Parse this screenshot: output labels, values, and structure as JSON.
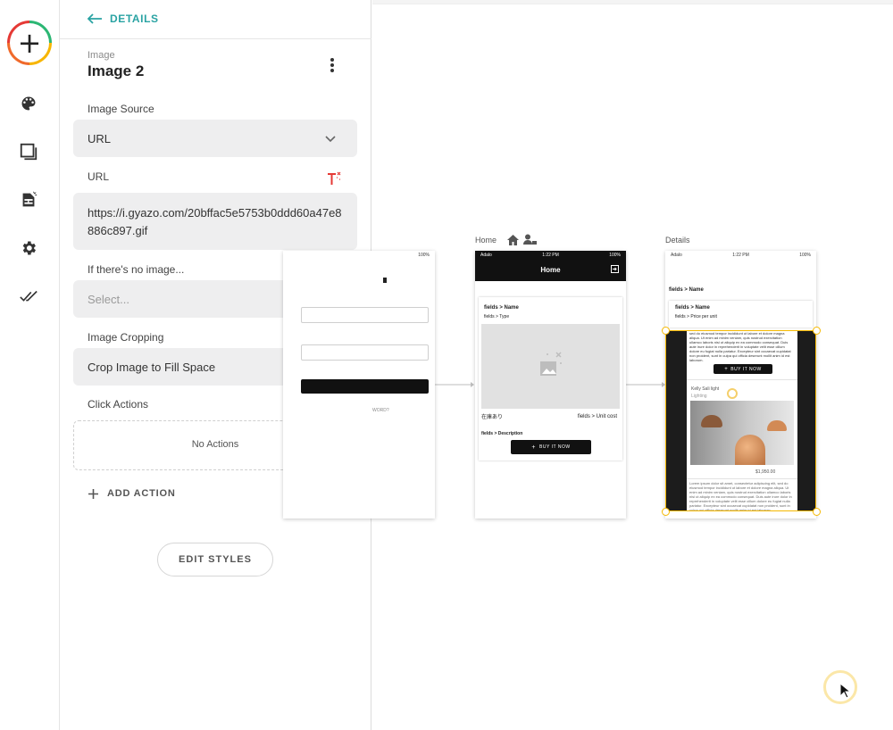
{
  "panel": {
    "back_label": "DETAILS",
    "component_kind": "Image",
    "component_name": "Image 2",
    "image_source": {
      "label": "Image Source",
      "value": "URL"
    },
    "url": {
      "label": "URL",
      "value": "https://i.gyazo.com/20bffac5e5753b0ddd60a47e8886c897.gif"
    },
    "no_image": {
      "label": "If there's no image...",
      "placeholder": "Select..."
    },
    "cropping": {
      "label": "Image Cropping",
      "value": "Crop Image to Fill Space"
    },
    "click_actions": {
      "label": "Click Actions",
      "empty_text": "No Actions"
    },
    "add_action": "ADD ACTION",
    "edit_styles": "EDIT STYLES"
  },
  "canvas": {
    "screen1": {
      "status_right": "100%",
      "forgot_text": "WORD?"
    },
    "home": {
      "label": "Home",
      "status_left": "Adalo",
      "status_time": "1:22 PM",
      "status_right": "100%",
      "header_title": "Home",
      "name_field": "fields > Name",
      "type_field": "fields > Type",
      "stock_text": "在庫あり",
      "unit_cost": "fields > Unit cost",
      "description": "fields > Description",
      "buy_button": "BUY IT NOW"
    },
    "details": {
      "label": "Details",
      "status_left": "Adalo",
      "status_time": "1:22 PM",
      "status_right": "100%",
      "name_top": "fields > Name",
      "name_field": "fields > Name",
      "price_field": "fields > Price per unit",
      "buy_button": "BUY IT NOW",
      "product_name": "Kelly Sali light",
      "product_category": "Lighting",
      "product_price": "$1,950.00",
      "lorem_top": "sed do eiusmod tempor incididunt ut labore et dolore magna aliqua. Ut enim ad minim veniam, quis nostrud exercitation ullamco laboris nisi ut aliquip ex ea commodo consequat. Duis aute irure dolor in reprehenderit in voluptate velit esse cillum dolore eu fugiat nulla pariatur. Excepteur sint occaecat cupidatat non proident, sunt in culpa qui officia deserunt mollit anim id est laborum.",
      "lorem_bottom": "Lorem ipsum dolor sit amet, consectetur adipiscing elit, sed do eiusmod tempor incididunt ut labore et dolore magna aliqua. Ut enim ad minim veniam, quis nostrud exercitation ullamco laboris nisi ut aliquip ex ea commodo consequat. Duis aute irure dolor in reprehenderit in voluptate velit esse cillum dolore eu fugiat nulla pariatur. Excepteur sint occaecat cupidatat non proident, sunt in culpa qui officia deserunt mollit anim id est laborum."
    }
  },
  "colors": {
    "accent": "#2aa3a3",
    "selection": "#f5b800",
    "magic_text": "#e53935"
  }
}
